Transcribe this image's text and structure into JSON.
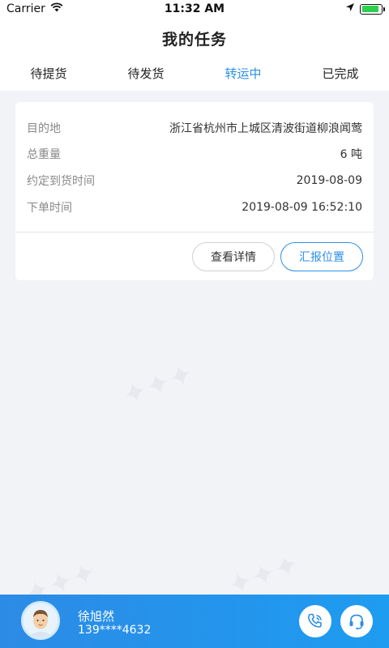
{
  "status_bar": {
    "carrier": "Carrier",
    "time": "11:32 AM",
    "battery_level": 0.9,
    "battery_color": "#2bd14b"
  },
  "nav": {
    "title": "我的任务"
  },
  "tabs": [
    {
      "label": "待提货",
      "active": false
    },
    {
      "label": "待发货",
      "active": false
    },
    {
      "label": "转运中",
      "active": true
    },
    {
      "label": "已完成",
      "active": false
    }
  ],
  "task_card": {
    "rows": [
      {
        "label": "目的地",
        "value": "浙江省杭州市上城区清波街道柳浪闻莺"
      },
      {
        "label": "总重量",
        "value": "6 吨"
      },
      {
        "label": "约定到货时间",
        "value": "2019-08-09"
      },
      {
        "label": "下单时间",
        "value": "2019-08-09 16:52:10"
      }
    ],
    "detail_button": "查看详情",
    "report_button": "汇报位置"
  },
  "driver": {
    "name": "徐旭然",
    "phone": "139****4632"
  },
  "colors": {
    "accent": "#2a8fe8",
    "footer": "#2c8be6"
  }
}
